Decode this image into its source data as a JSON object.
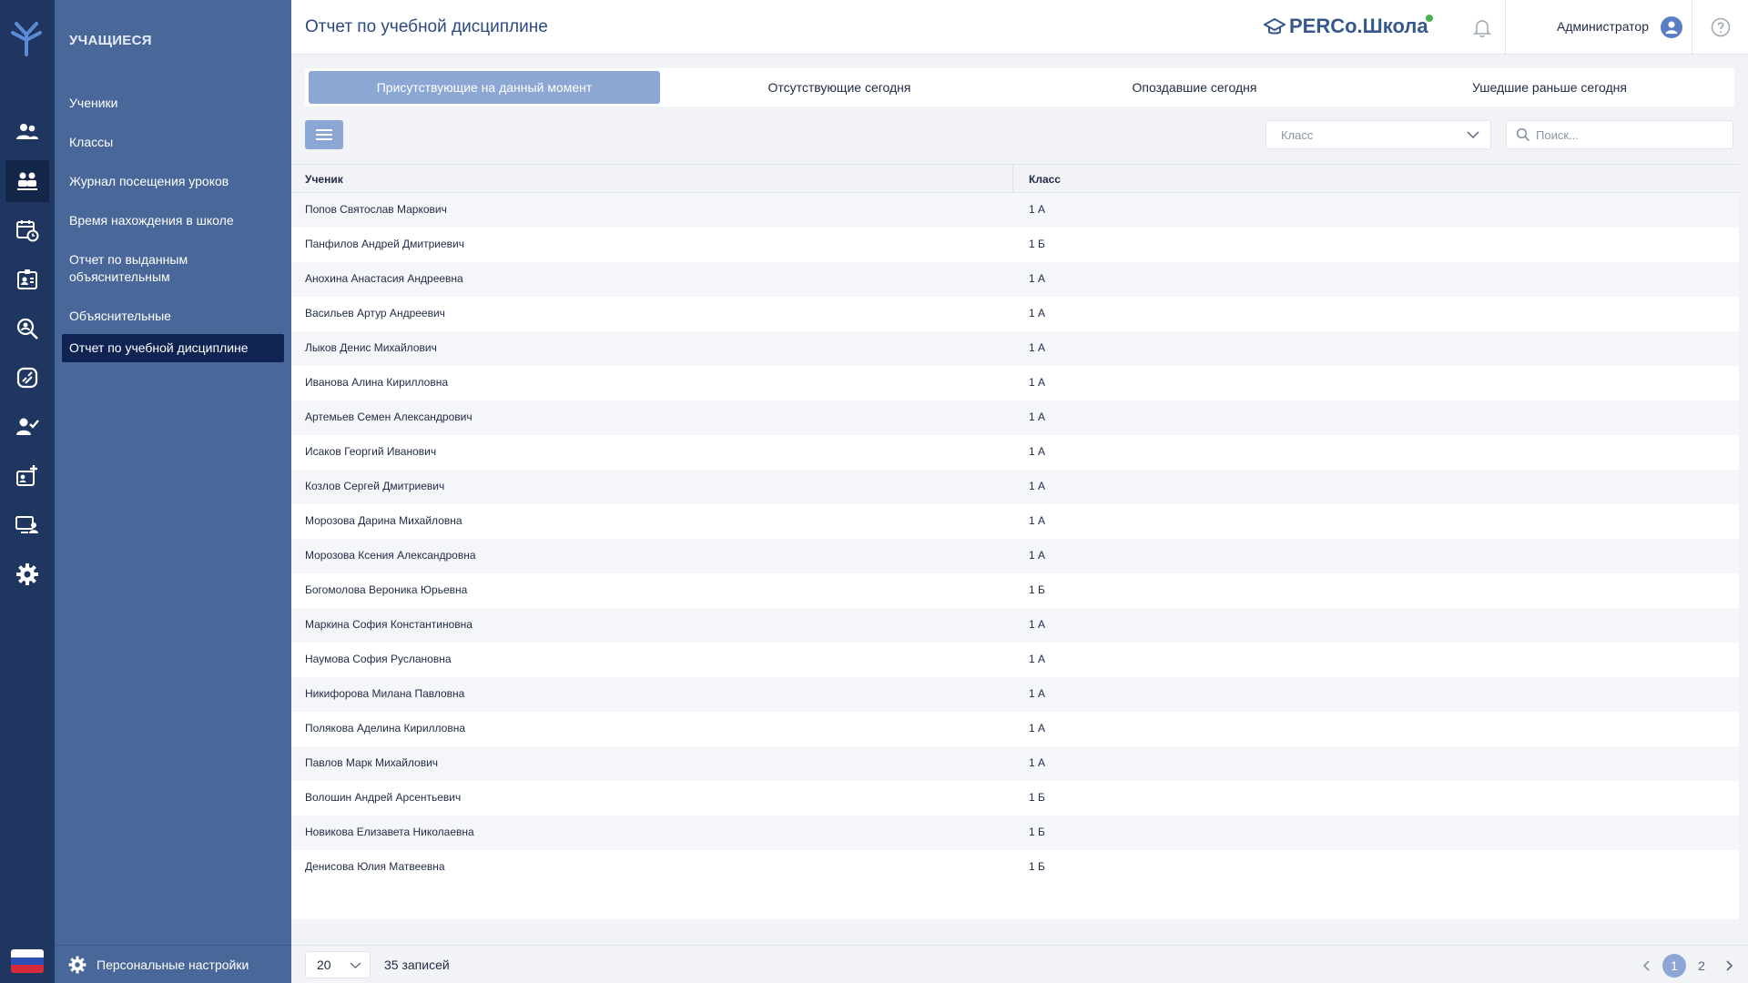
{
  "sidebar": {
    "section_title": "УЧАЩИЕСЯ",
    "items": [
      {
        "label": "Ученики"
      },
      {
        "label": "Классы"
      },
      {
        "label": "Журнал посещения уроков"
      },
      {
        "label": "Время нахождения в школе"
      },
      {
        "label": "Отчет по выданным объяснительным"
      },
      {
        "label": "Объяснительные"
      },
      {
        "label": "Отчет по учебной дисциплине",
        "active": true
      }
    ],
    "footer_label": "Персональные настройки"
  },
  "rail": {
    "icons": [
      "logo-icon",
      "users-icon",
      "students-icon",
      "calendar-clock-icon",
      "badge-icon",
      "search-location-icon",
      "pass-icon",
      "user-check-icon",
      "add-badge-icon",
      "monitor-user-icon",
      "settings-icon"
    ],
    "active_icon": "students-icon",
    "language_flag": "ru-flag-icon"
  },
  "header": {
    "title": "Отчет по учебной дисциплине",
    "brand": "PERCo.Школа",
    "user": "Администратор"
  },
  "tabs": [
    {
      "label": "Присутствующие на данный момент",
      "active": true
    },
    {
      "label": "Отсутствующие сегодня"
    },
    {
      "label": "Опоздавшие сегодня"
    },
    {
      "label": "Ушедшие раньше сегодня"
    }
  ],
  "filters": {
    "class_placeholder": "Класс",
    "search_placeholder": "Поиск..."
  },
  "table": {
    "columns": [
      "Ученик",
      "Класс"
    ],
    "rows": [
      [
        "Попов Святослав Маркович",
        "1 А"
      ],
      [
        "Панфилов Андрей Дмитриевич",
        "1 Б"
      ],
      [
        "Анохина Анастасия Андреевна",
        "1 А"
      ],
      [
        "Васильев Артур Андреевич",
        "1 А"
      ],
      [
        "Лыков Денис Михайлович",
        "1 А"
      ],
      [
        "Иванова Алина Кирилловна",
        "1 А"
      ],
      [
        "Артемьев Семен Александрович",
        "1 А"
      ],
      [
        "Исаков Георгий Иванович",
        "1 А"
      ],
      [
        "Козлов Сергей Дмитриевич",
        "1 А"
      ],
      [
        "Морозова Дарина Михайловна",
        "1 А"
      ],
      [
        "Морозова Ксения Александровна",
        "1 А"
      ],
      [
        "Богомолова Вероника Юрьевна",
        "1 Б"
      ],
      [
        "Маркина София Константиновна",
        "1 А"
      ],
      [
        "Наумова София Руслановна",
        "1 А"
      ],
      [
        "Никифорова Милана Павловна",
        "1 А"
      ],
      [
        "Полякова Аделина Кирилловна",
        "1 А"
      ],
      [
        "Павлов Марк Михайлович",
        "1 А"
      ],
      [
        "Волошин Андрей Арсентьевич",
        "1 Б"
      ],
      [
        "Новикова Елизавета Николаевна",
        "1 Б"
      ],
      [
        "Денисова Юлия Матвеевна",
        "1 Б"
      ]
    ]
  },
  "pagination": {
    "page_size": "20",
    "records": "35 записей",
    "pages": [
      "1",
      "2"
    ],
    "current_page": "1"
  },
  "colors": {
    "rail_bg": "#1f3661",
    "sidebar_bg": "#4a6799",
    "sidebar_active": "#0f2452",
    "accent": "#8da7d4",
    "title": "#2a4a7f",
    "status_dot": "#4caf50"
  }
}
